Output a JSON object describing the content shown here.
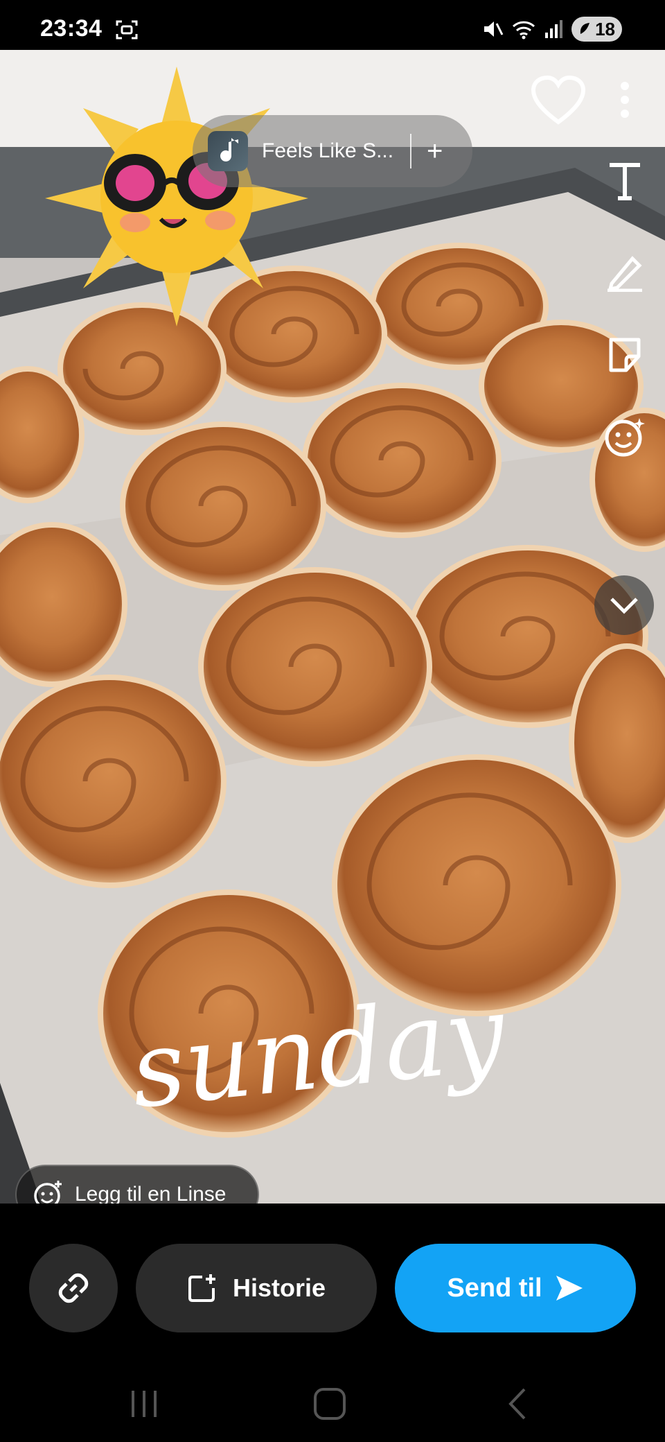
{
  "status_bar": {
    "time": "23:34",
    "battery": "18",
    "icons": [
      "screenshot-icon",
      "mute-icon",
      "wifi-icon",
      "signal-icon",
      "battery-saver-icon"
    ]
  },
  "music": {
    "title": "Feels Like S...",
    "add_label": "+"
  },
  "caption": {
    "text": "sunday"
  },
  "toolbar": {
    "icons": [
      "heart-icon",
      "more-icon",
      "text-tool-icon",
      "pencil-icon",
      "sticker-icon",
      "lens-face-icon",
      "chevron-down-icon"
    ]
  },
  "lens": {
    "label": "Legg til en Linse"
  },
  "actions": {
    "story_label": "Historie",
    "send_label": "Send til"
  },
  "colors": {
    "send_button": "#13a3f5",
    "dark_button": "#2b2b2b"
  }
}
